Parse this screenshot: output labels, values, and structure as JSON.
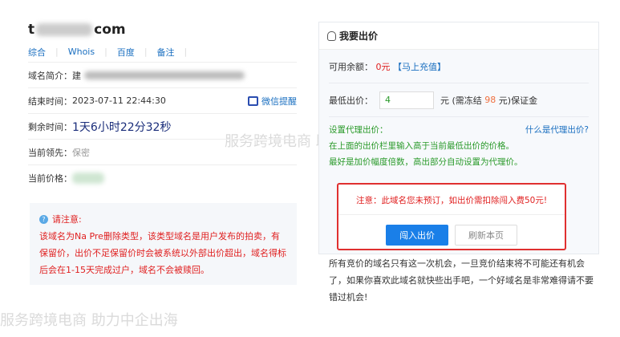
{
  "domain": {
    "prefix": "t",
    "suffix": "com"
  },
  "links": [
    "综合",
    "Whois",
    "百度",
    "备注"
  ],
  "rows": {
    "intro_label": "域名简介：",
    "intro_value": "建",
    "end_label": "结束时间：",
    "end_value": "2023-07-11 22:44:30",
    "wechat": "微信提醒",
    "remain_label": "剩余时间：",
    "remain_value": "1天6小时22分32秒",
    "leader_label": "当前领先：",
    "leader_value": "保密",
    "price_label": "当前价格："
  },
  "notice": {
    "title": "请注意:",
    "text": "该域名为Na    Pre删除类型，该类型域名是用户发布的拍卖，有保留价，出价不足保留价时会被系统以外部出价超出，域名得标后会在1-15天完成过户，域名不会被赎回。"
  },
  "panel": {
    "title": "我要出价",
    "balance_label": "可用余额：",
    "balance_value": "0元",
    "recharge": "【马上充值】",
    "minbid_label": "最低出价：",
    "minbid_value": "4",
    "freeze_prefix": "元 (需冻结",
    "freeze_value": "98",
    "freeze_suffix": "元)保证金",
    "proxy_label": "设置代理出价：",
    "proxy_help": "什么是代理出价?",
    "proxy_line1": "在上面的出价栏里输入高于当前最低出价的价格。",
    "proxy_line2": "最好是加价幅度倍数，高出部分自动设置为代理价。",
    "warning": "注意：此域名您未预订，如出价需扣除闯入费50元!",
    "bid_button": "闯入出价",
    "refresh_button": "刷新本页"
  },
  "footer": "所有竞价的域名只有这一次机会，一旦竞价结束将不可能还有机会了，如果你喜欢此域名就快些出手吧，一个好域名是非常难得请不要错过机会!",
  "watermark": "服务跨境电商 助力中企出海"
}
